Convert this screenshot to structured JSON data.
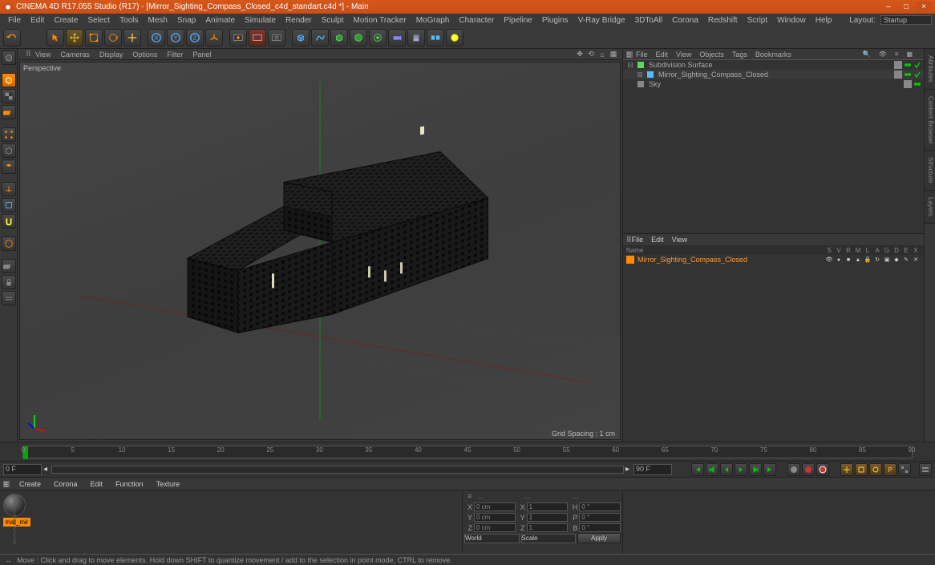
{
  "title": "CINEMA 4D R17.055 Studio (R17) - [Mirror_Sighting_Compass_Closed_c4d_standart.c4d *] - Main",
  "window_buttons": {
    "min": "–",
    "max": "□",
    "close": "×"
  },
  "menu": [
    "File",
    "Edit",
    "Create",
    "Select",
    "Tools",
    "Mesh",
    "Snap",
    "Animate",
    "Simulate",
    "Render",
    "Sculpt",
    "Motion Tracker",
    "MoGraph",
    "Character",
    "Pipeline",
    "Plugins",
    "V-Ray Bridge",
    "3DToAll",
    "Corona",
    "Redshift",
    "Script",
    "Window",
    "Help"
  ],
  "layout_label": "Layout:",
  "layout_value": "Startup",
  "viewport_menu": [
    "View",
    "Cameras",
    "Display",
    "Options",
    "Filter",
    "Panel"
  ],
  "viewport_label": "Perspective",
  "grid_label": "Grid Spacing : 1 cm",
  "object_panel_menu": [
    "File",
    "Edit",
    "View",
    "Objects",
    "Tags",
    "Bookmarks"
  ],
  "objects": [
    {
      "indent": 0,
      "expander": "⊟",
      "icon": "subdiv",
      "name": "Subdivision Surface",
      "sel": false
    },
    {
      "indent": 1,
      "expander": "⊞",
      "icon": "poly",
      "name": "Mirror_Sighting_Compass_Closed",
      "sel": true
    },
    {
      "indent": 0,
      "expander": "",
      "icon": "sky",
      "name": "Sky",
      "sel": false
    }
  ],
  "layers_menu": [
    "File",
    "Edit",
    "View"
  ],
  "layer_header": "Name",
  "layer_cols": [
    "S",
    "V",
    "R",
    "M",
    "L",
    "A",
    "G",
    "D",
    "E",
    "X"
  ],
  "layers": [
    {
      "name": "Mirror_Sighting_Compass_Closed"
    }
  ],
  "timeline": {
    "marks": [
      0,
      5,
      10,
      15,
      20,
      25,
      30,
      35,
      40,
      45,
      50,
      55,
      60,
      65,
      70,
      75,
      80,
      85,
      90
    ],
    "start": "0 F",
    "end": "90 F",
    "cur_start": "0 F",
    "cur_end": "90 F"
  },
  "material_tabs": [
    "Create",
    "Corona",
    "Edit",
    "Function",
    "Texture"
  ],
  "materials": [
    {
      "name": "mat_mir"
    }
  ],
  "coords": {
    "headers": [
      "...",
      "...",
      "..."
    ],
    "rows": [
      {
        "a": "X",
        "av": "0 cm",
        "b": "X",
        "bv": "1",
        "c": "H",
        "cv": "0 °"
      },
      {
        "a": "Y",
        "av": "0 cm",
        "b": "Y",
        "bv": "1",
        "c": "P",
        "cv": "0 °"
      },
      {
        "a": "Z",
        "av": "0 cm",
        "b": "Z",
        "bv": "1",
        "c": "B",
        "cv": "0 °"
      }
    ],
    "sel1": "World",
    "sel2": "Scale",
    "apply": "Apply"
  },
  "status": "Move : Click and drag to move elements. Hold down SHIFT to quantize movement / add to the selection in point mode, CTRL to remove.",
  "right_tabs": [
    "Attributes",
    "Content Browser",
    "Structure",
    "Layers"
  ]
}
